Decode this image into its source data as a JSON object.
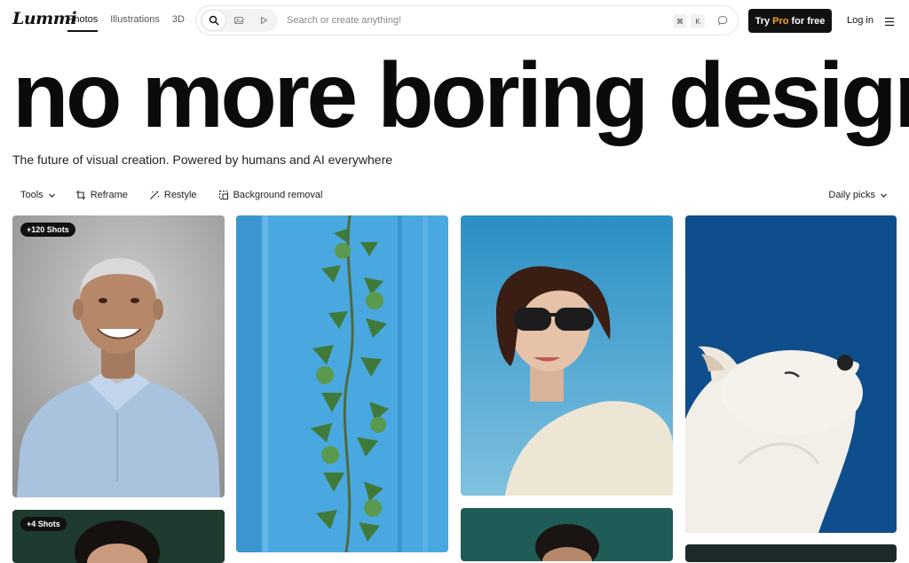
{
  "header": {
    "logo": "Lummi",
    "tabs": [
      {
        "label": "Photos",
        "active": true
      },
      {
        "label": "Illustrations",
        "active": false
      },
      {
        "label": "3D",
        "active": false
      }
    ],
    "search": {
      "placeholder": "Search or create anything!",
      "value": "",
      "shortcut_cmd": "⌘",
      "shortcut_key": "K"
    },
    "try_pro": {
      "prefix": "Try",
      "pro": "Pro",
      "suffix": "for free"
    },
    "login": "Log in"
  },
  "hero": {
    "title": "no more boring design",
    "subtitle": "The future of visual creation. Powered by humans and AI everywhere"
  },
  "toolbar": {
    "tools_label": "Tools",
    "items": [
      "Reframe",
      "Restyle",
      "Background removal"
    ],
    "sort_label": "Daily picks"
  },
  "gallery": {
    "cards": [
      {
        "badge": "+120 Shots",
        "subject": "smiling older man in light blue polo shirt"
      },
      {
        "badge": "",
        "subject": "ivy vine climbing a blue wall"
      },
      {
        "badge": "",
        "subject": "woman with sunglasses in cream sweater"
      },
      {
        "badge": "",
        "subject": "white arctic fox against blue"
      },
      {
        "badge": "+4 Shots",
        "subject": "portrait on dark green background"
      }
    ]
  },
  "colors": {
    "accent_pro": "#f5a623",
    "button_bg": "#111111"
  }
}
